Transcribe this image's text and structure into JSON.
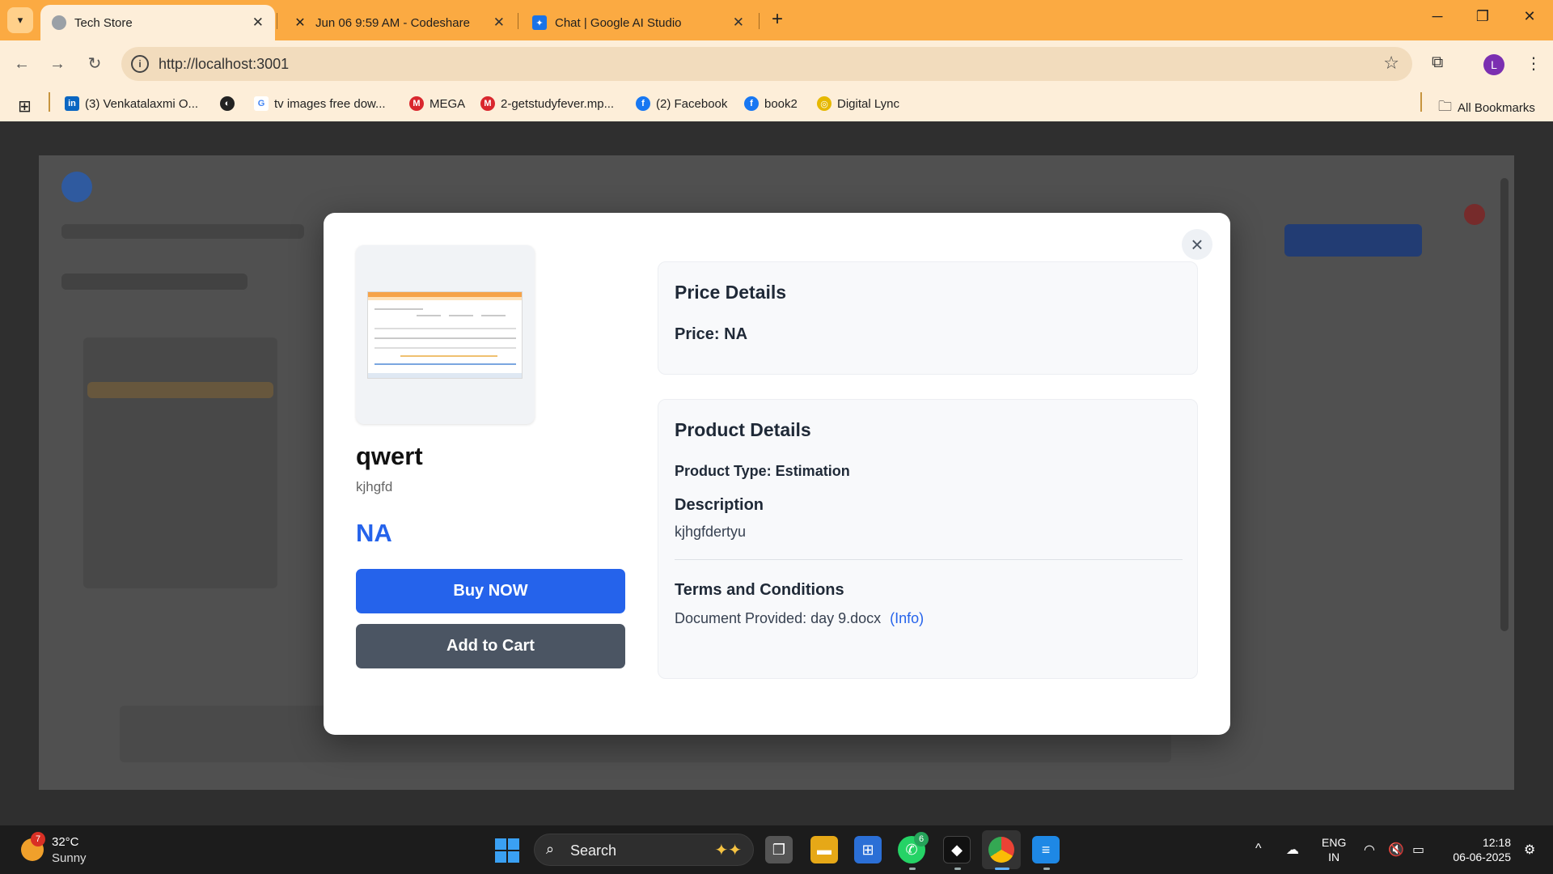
{
  "browser": {
    "tabs": [
      {
        "title": "Tech Store",
        "active": true
      },
      {
        "title": "Jun 06 9:59 AM - Codeshare",
        "active": false
      },
      {
        "title": "Chat | Google AI Studio",
        "active": false
      }
    ],
    "url": "http://localhost:3001",
    "profile_initial": "L",
    "bookmarks": [
      {
        "label": "(3) Venkatalaxmi O...",
        "icon": "linkedin-icon"
      },
      {
        "label": "",
        "icon": "globe-icon"
      },
      {
        "label": "tv images free dow...",
        "icon": "google-icon"
      },
      {
        "label": "MEGA",
        "icon": "mega-icon"
      },
      {
        "label": "2-getstudyfever.mp...",
        "icon": "mega-icon"
      },
      {
        "label": "(2) Facebook",
        "icon": "facebook-icon"
      },
      {
        "label": "book2",
        "icon": "facebook-icon"
      },
      {
        "label": "Digital Lync",
        "icon": "digital-lync-icon"
      }
    ],
    "all_bookmarks": "All Bookmarks",
    "colors": {
      "chrome": "#fbaa42",
      "toolbar": "#fdeed9"
    }
  },
  "modal": {
    "product_name": "qwert",
    "product_subtitle": "kjhgfd",
    "price_display": "NA",
    "buy_label": "Buy NOW",
    "cart_label": "Add to Cart",
    "price_details": {
      "heading": "Price Details",
      "price_text": "Price: NA"
    },
    "product_details": {
      "heading": "Product Details",
      "type_text": "Product Type: Estimation",
      "description_heading": "Description",
      "description": "kjhgfdertyu",
      "terms_heading": "Terms and Conditions",
      "document_text": "Document Provided: day 9.docx",
      "info_link": "(Info)"
    },
    "colors": {
      "primary": "#2563eb",
      "secondary": "#4b5563"
    }
  },
  "taskbar": {
    "weather_temp": "32°C",
    "weather_desc": "Sunny",
    "weather_badge": "7",
    "search_label": "Search",
    "whatsapp_badge": "6",
    "lang_top": "ENG",
    "lang_bottom": "IN",
    "time": "12:18",
    "date": "06-06-2025"
  }
}
